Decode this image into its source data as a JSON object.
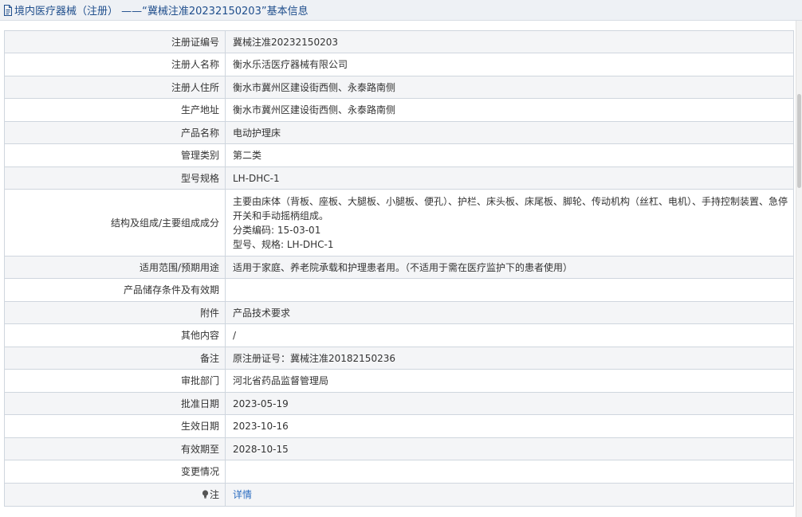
{
  "header": {
    "title": "境内医疗器械（注册） ——“冀械注准20232150203”基本信息"
  },
  "rows": [
    {
      "label": "注册证编号",
      "value": "冀械注准20232150203"
    },
    {
      "label": "注册人名称",
      "value": "衡水乐活医疗器械有限公司"
    },
    {
      "label": "注册人住所",
      "value": "衡水市冀州区建设街西侧、永泰路南侧"
    },
    {
      "label": "生产地址",
      "value": "衡水市冀州区建设街西侧、永泰路南侧"
    },
    {
      "label": "产品名称",
      "value": "电动护理床"
    },
    {
      "label": "管理类别",
      "value": "第二类"
    },
    {
      "label": "型号规格",
      "value": "LH-DHC-1"
    }
  ],
  "structure": {
    "label": "结构及组成/主要组成成分",
    "line1": "主要由床体（背板、座板、大腿板、小腿板、便孔）、护栏、床头板、床尾板、脚轮、传动机构（丝杠、电机）、手持控制装置、急停开关和手动摇柄组成。",
    "line2": "分类编码: 15-03-01",
    "line3": "型号、规格: LH-DHC-1"
  },
  "rows2": [
    {
      "label": "适用范围/预期用途",
      "value": "适用于家庭、养老院承载和护理患者用。（不适用于需在医疗监护下的患者使用）"
    },
    {
      "label": "产品储存条件及有效期",
      "value": ""
    },
    {
      "label": "附件",
      "value": "产品技术要求"
    },
    {
      "label": "其他内容",
      "value": "/"
    },
    {
      "label": "备注",
      "value": "原注册证号：冀械注准20182150236"
    },
    {
      "label": "审批部门",
      "value": "河北省药品监督管理局"
    },
    {
      "label": "批准日期",
      "value": "2023-05-19"
    },
    {
      "label": "生效日期",
      "value": "2023-10-16"
    },
    {
      "label": "有效期至",
      "value": "2028-10-15"
    },
    {
      "label": "变更情况",
      "value": ""
    }
  ],
  "note": {
    "label": "注",
    "link_text": "详情"
  },
  "colors": {
    "header_bg": "#eef1f5",
    "header_text": "#1f4e8c",
    "border": "#cfd6de",
    "odd_row": "#f4f5f7",
    "link": "#2a6cc0"
  }
}
